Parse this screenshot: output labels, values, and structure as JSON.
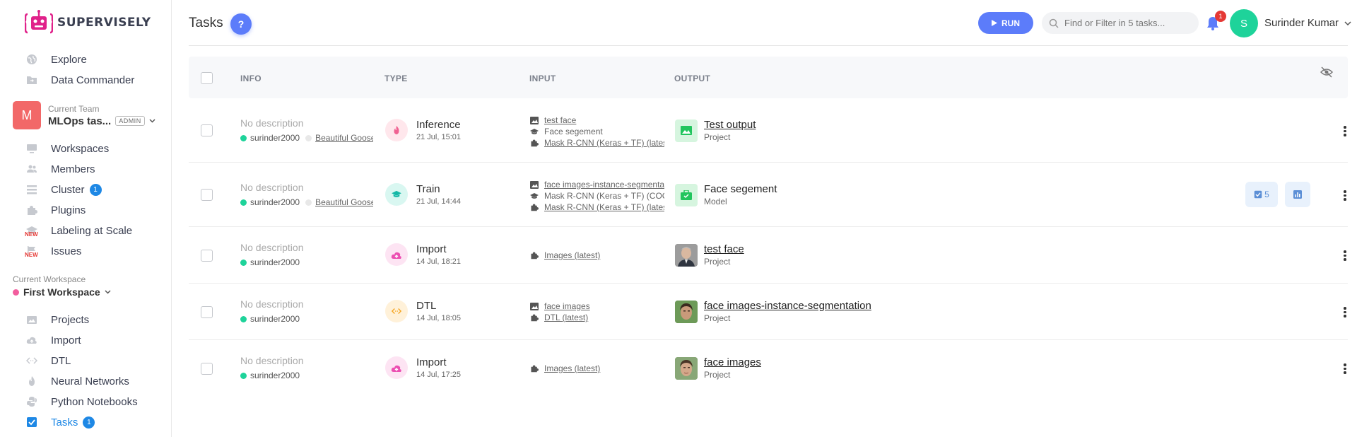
{
  "app": {
    "logo_text": "SUPERVISELY"
  },
  "sidebar": {
    "top_items": [
      {
        "label": "Explore",
        "icon": "globe-icon"
      },
      {
        "label": "Data Commander",
        "icon": "folder-icon"
      }
    ],
    "team": {
      "label": "Current Team",
      "avatar_letter": "M",
      "name": "MLOps tas...",
      "role": "ADMIN"
    },
    "team_items": [
      {
        "label": "Workspaces",
        "icon": "monitor-icon"
      },
      {
        "label": "Members",
        "icon": "users-icon"
      },
      {
        "label": "Cluster",
        "icon": "list-icon",
        "badge": "1"
      },
      {
        "label": "Plugins",
        "icon": "puzzle-icon"
      },
      {
        "label": "Labeling at Scale",
        "icon": "graduation-cap-icon",
        "new": "NEW"
      },
      {
        "label": "Issues",
        "icon": "flag-icon",
        "new": "NEW"
      }
    ],
    "workspace": {
      "label": "Current Workspace",
      "name": "First Workspace"
    },
    "ws_items": [
      {
        "label": "Projects",
        "icon": "images-icon"
      },
      {
        "label": "Import",
        "icon": "cloud-upload-icon"
      },
      {
        "label": "DTL",
        "icon": "code-icon"
      },
      {
        "label": "Neural Networks",
        "icon": "flame-icon"
      },
      {
        "label": "Python Notebooks",
        "icon": "python-icon"
      },
      {
        "label": "Tasks",
        "icon": "checkbox-icon",
        "badge": "1"
      }
    ]
  },
  "header": {
    "title": "Tasks",
    "help": "?",
    "run_label": "RUN",
    "search_placeholder": "Find or Filter in 5 tasks...",
    "notifications": "1",
    "user_initial": "S",
    "user_name": "Surinder Kumar"
  },
  "table": {
    "columns": [
      "INFO",
      "TYPE",
      "INPUT",
      "OUTPUT"
    ],
    "rows": [
      {
        "description": "No description",
        "owner": "surinder2000",
        "agent": "Beautiful Goose",
        "type": "Inference",
        "date": "21 Jul, 15:01",
        "inputs": [
          "test face",
          "Face segement",
          "Mask R-CNN (Keras + TF) (latest)"
        ],
        "output_name": "Test output",
        "output_kind": "Project"
      },
      {
        "description": "No description",
        "owner": "surinder2000",
        "agent": "Beautiful Goose",
        "type": "Train",
        "date": "21 Jul, 14:44",
        "inputs": [
          "face images-instance-segmentation",
          "Mask R-CNN (Keras + TF) (COCO)",
          "Mask R-CNN (Keras + TF) (latest)"
        ],
        "output_name": "Face segement",
        "output_kind": "Model",
        "checkpoints": "5"
      },
      {
        "description": "No description",
        "owner": "surinder2000",
        "type": "Import",
        "date": "14 Jul, 18:21",
        "inputs": [
          "Images (latest)"
        ],
        "output_name": "test face",
        "output_kind": "Project"
      },
      {
        "description": "No description",
        "owner": "surinder2000",
        "type": "DTL",
        "date": "14 Jul, 18:05",
        "inputs": [
          "face images",
          "DTL (latest)"
        ],
        "output_name": "face images-instance-segmentation",
        "output_kind": "Project"
      },
      {
        "description": "No description",
        "owner": "surinder2000",
        "type": "Import",
        "date": "14 Jul, 17:25",
        "inputs": [
          "Images (latest)"
        ],
        "output_name": "face images",
        "output_kind": "Project"
      }
    ]
  },
  "colors": {
    "accent": "#5c7cfa",
    "inference": "#ffe7ec",
    "train": "#d9f7f1",
    "import": "#fde4f3",
    "dtl": "#fff1d9"
  }
}
